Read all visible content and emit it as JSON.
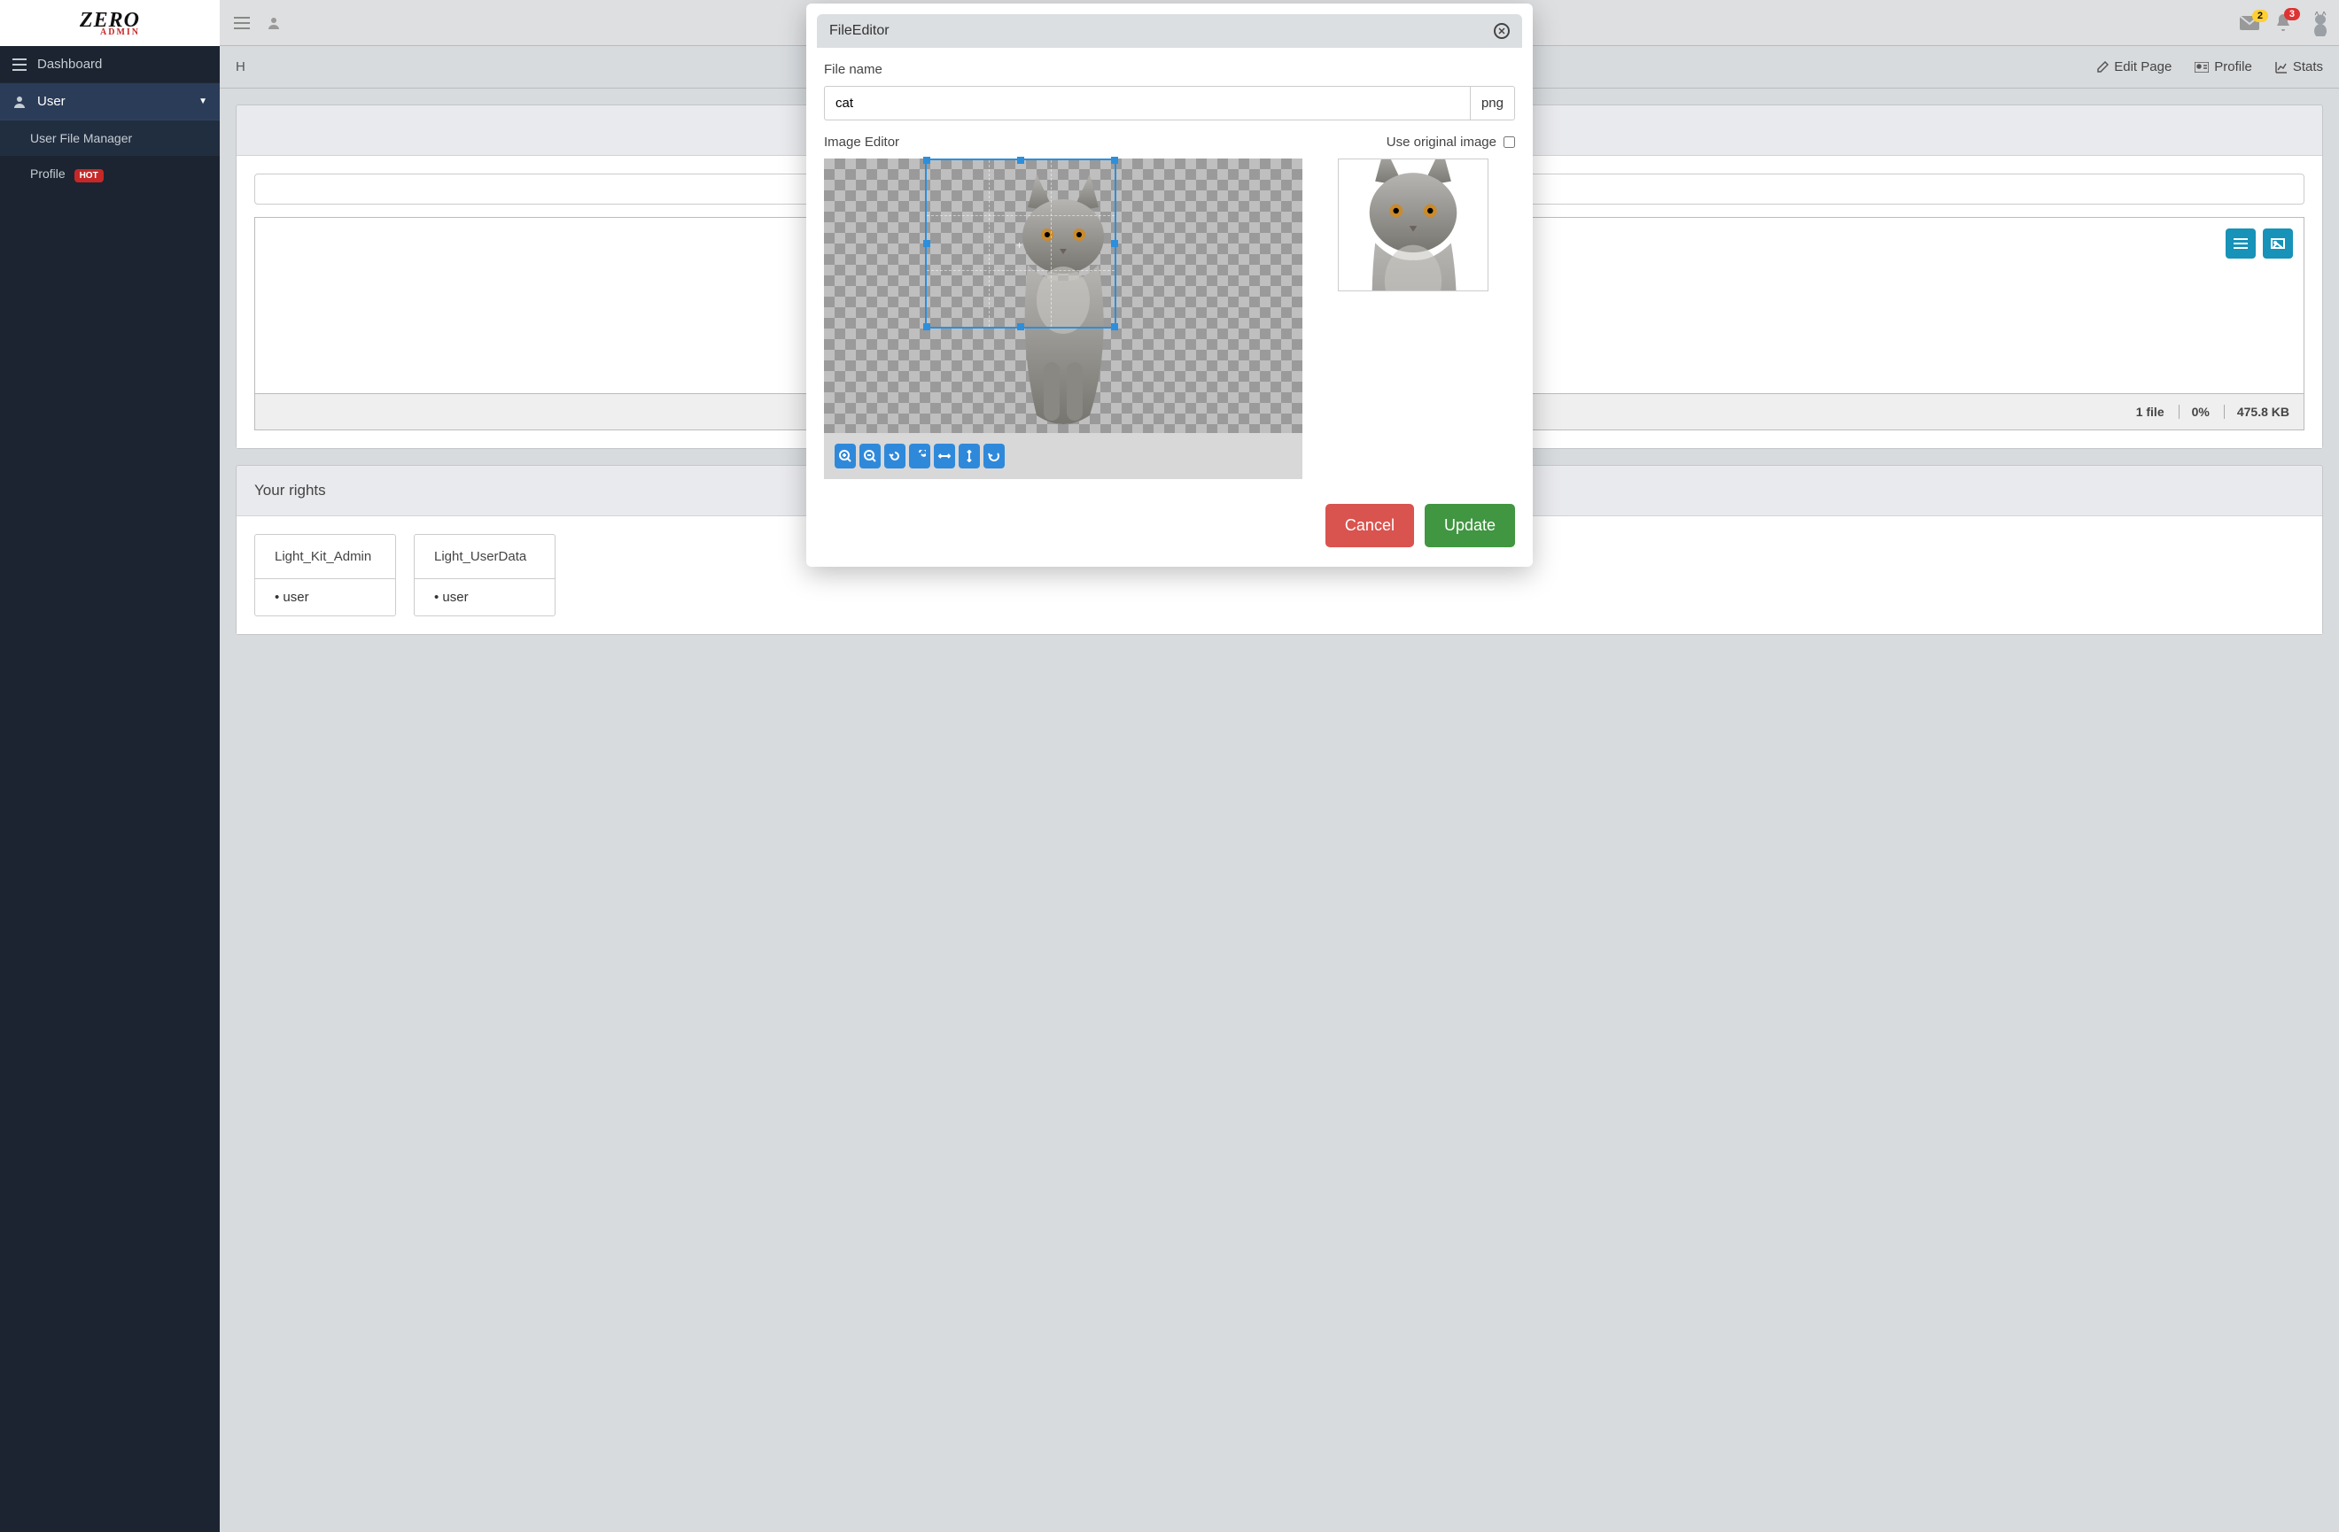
{
  "logo": {
    "main": "ZERO",
    "sub": "ADMIN"
  },
  "sidebar": {
    "items": [
      {
        "label": "Dashboard",
        "icon": "menu"
      },
      {
        "label": "User",
        "icon": "user",
        "expanded": true,
        "children": [
          {
            "label": "User File Manager"
          },
          {
            "label": "Profile",
            "hot": "HOT"
          }
        ]
      }
    ]
  },
  "topbar": {
    "messages_badge": "2",
    "notifications_badge": "3"
  },
  "toolbar": {
    "crumb_home": "H",
    "edit_page": "Edit Page",
    "profile": "Profile",
    "stats": "Stats"
  },
  "filemanager": {
    "panel_title": "",
    "search_value": "",
    "footer_files": "1 file",
    "footer_pct": "0%",
    "footer_size": "475.8 KB"
  },
  "rights": {
    "title": "Your rights",
    "cards": [
      {
        "title": "Light_Kit_Admin",
        "items": [
          "user"
        ]
      },
      {
        "title": "Light_UserData",
        "items": [
          "user"
        ]
      }
    ]
  },
  "modal": {
    "title": "FileEditor",
    "file_name_label": "File name",
    "file_name_value": "cat",
    "file_ext": "png",
    "image_editor_label": "Image Editor",
    "use_original_label": "Use original image",
    "use_original_checked": false,
    "tool_icons": [
      "zoom-in",
      "zoom-out",
      "rotate-left",
      "rotate-right",
      "flip-h",
      "flip-v",
      "reset"
    ],
    "cancel": "Cancel",
    "update": "Update"
  }
}
